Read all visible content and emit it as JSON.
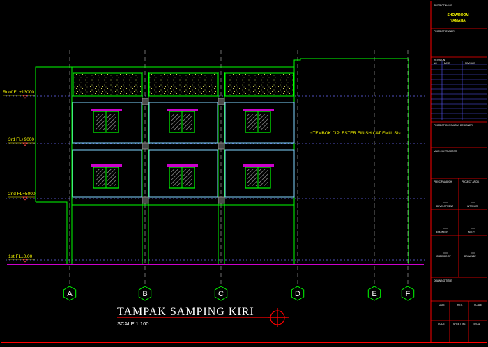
{
  "drawing": {
    "title": "TAMPAK SAMPING KIRI",
    "scale": "SCALE 1:100",
    "note": "~TEMBOK DIPLESTER FINISH CAT EMULSI~"
  },
  "levels": [
    {
      "label": "Roof FL+13000"
    },
    {
      "label": "3rd FL+9000"
    },
    {
      "label": "2nd FL+5000"
    },
    {
      "label": "1st FL±0.00"
    }
  ],
  "grid_labels": [
    "A",
    "B",
    "C",
    "D",
    "E",
    "F"
  ],
  "title_block": {
    "project_name_label": "PROJECT NAME",
    "project_name_line1": "SHOWROOM",
    "project_name_line2": "YAMAHA",
    "project_owner_label": "PROJECT OWNER",
    "revision_label": "REVISION",
    "rev_col_no": "NO",
    "rev_col_date": "DATE",
    "rev_col_revision": "REVISION",
    "consultant_label": "PROJECT CONSULTAN DESIGNER",
    "contractor_label": "MAIN CONTRACTOR",
    "principal_arch": "PRINCIPAL ARCH.",
    "project_arch": "PROJECT ARCH.",
    "development": "DEVELOPMENT",
    "interior": "INTERIOR",
    "engineer": "ENGINEER",
    "m_e": "M.E.P.",
    "checked_by": "CHECKED BY",
    "drawn_by": "DRAWN BY",
    "drawing_title_label": "DRAWING TITLE",
    "date_label": "DATE",
    "rev_label": "REV.",
    "scale_label": "SCALE",
    "code_label": "CODE",
    "sheet_no_label": "SHEET NO.",
    "total_label": "TOTAL"
  },
  "colors": {
    "background": "#000000",
    "frame": "#ff0000",
    "wall": "#00ff00",
    "panel": "#7fd6ff",
    "grid": "#8a8a8a",
    "level_line": "#6a6aff",
    "ground": "#cc00cc",
    "level_text": "#ffff00",
    "window_frame": "#00ff00",
    "window_glass": "#9a9a9a",
    "lintel": "#cc00cc",
    "grid_bubble": "#00ff00",
    "text_white": "#ffffff",
    "title_yellow": "#ffff00"
  }
}
